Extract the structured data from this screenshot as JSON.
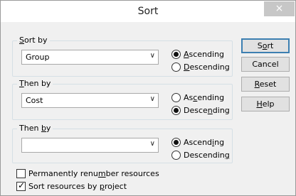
{
  "window": {
    "title": "Sort",
    "close_glyph": "×"
  },
  "sort_by": {
    "label": "Sort by",
    "value": "Group",
    "options": {
      "ascending": "Ascending",
      "descending": "Descending",
      "selected": "ascending"
    }
  },
  "then_by_1": {
    "label": "Then by",
    "value": "Cost",
    "options": {
      "ascending": "Ascending",
      "descending": "Descending",
      "selected": "descending"
    }
  },
  "then_by_2": {
    "label": "Then by",
    "value": "",
    "options": {
      "ascending": "Ascending",
      "descending": "Descending",
      "selected": "ascending"
    }
  },
  "buttons": {
    "sort": "Sort",
    "cancel": "Cancel",
    "reset": "Reset",
    "help": "Help"
  },
  "checkboxes": {
    "renumber": {
      "label": "Permanently renumber resources",
      "checked": false
    },
    "by_project": {
      "label": "Sort resources by project",
      "checked": true
    }
  },
  "icons": {
    "dropdown": "chevron-down-icon",
    "close": "close-icon"
  }
}
